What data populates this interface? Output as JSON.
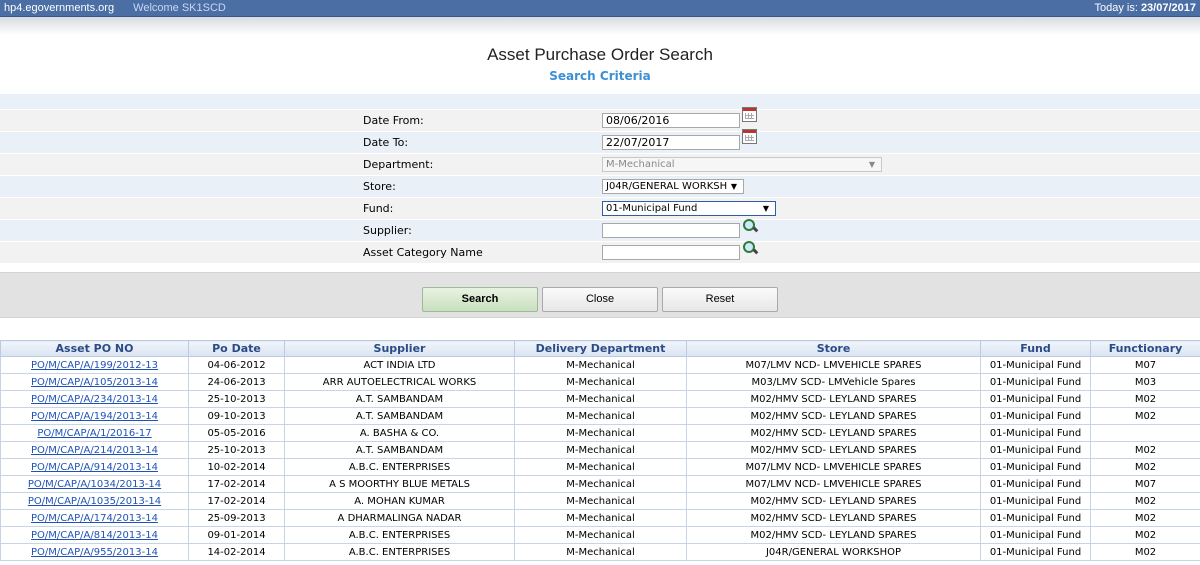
{
  "topbar": {
    "site": "hp4.egovernments.org",
    "welcome": "Welcome SK1SCD",
    "today_label": "Today is: ",
    "today_date": "23/07/2017"
  },
  "page_title": "Asset Purchase Order Search",
  "section_title": "Search Criteria",
  "form": {
    "date_from_label": "Date From:",
    "date_from_value": "08/06/2016",
    "date_to_label": "Date To:",
    "date_to_value": "22/07/2017",
    "department_label": "Department:",
    "department_value": "M-Mechanical",
    "store_label": "Store:",
    "store_value": "J04R/GENERAL WORKSH",
    "fund_label": "Fund:",
    "fund_value": "01-Municipal Fund",
    "supplier_label": "Supplier:",
    "supplier_value": "",
    "asset_category_label": "Asset Category Name",
    "asset_category_value": ""
  },
  "buttons": {
    "search": "Search",
    "close": "Close",
    "reset": "Reset"
  },
  "table": {
    "headers": [
      "Asset PO NO",
      "Po Date",
      "Supplier",
      "Delivery Department",
      "Store",
      "Fund",
      "Functionary"
    ],
    "rows": [
      [
        "PO/M/CAP/A/199/2012-13",
        "04-06-2012",
        "ACT INDIA LTD",
        "M-Mechanical",
        "M07/LMV NCD- LMVEHICLE SPARES",
        "01-Municipal Fund",
        "M07"
      ],
      [
        "PO/M/CAP/A/105/2013-14",
        "24-06-2013",
        "ARR AUTOELECTRICAL WORKS",
        "M-Mechanical",
        "M03/LMV SCD- LMVehicle Spares",
        "01-Municipal Fund",
        "M03"
      ],
      [
        "PO/M/CAP/A/234/2013-14",
        "25-10-2013",
        "A.T. SAMBANDAM",
        "M-Mechanical",
        "M02/HMV SCD- LEYLAND SPARES",
        "01-Municipal Fund",
        "M02"
      ],
      [
        "PO/M/CAP/A/194/2013-14",
        "09-10-2013",
        "A.T. SAMBANDAM",
        "M-Mechanical",
        "M02/HMV SCD- LEYLAND SPARES",
        "01-Municipal Fund",
        "M02"
      ],
      [
        "PO/M/CAP/A/1/2016-17",
        "05-05-2016",
        "A. BASHA & CO.",
        "M-Mechanical",
        "M02/HMV SCD- LEYLAND SPARES",
        "01-Municipal Fund",
        ""
      ],
      [
        "PO/M/CAP/A/214/2013-14",
        "25-10-2013",
        "A.T. SAMBANDAM",
        "M-Mechanical",
        "M02/HMV SCD- LEYLAND SPARES",
        "01-Municipal Fund",
        "M02"
      ],
      [
        "PO/M/CAP/A/914/2013-14",
        "10-02-2014",
        "A.B.C. ENTERPRISES",
        "M-Mechanical",
        "M07/LMV NCD- LMVEHICLE SPARES",
        "01-Municipal Fund",
        "M02"
      ],
      [
        "PO/M/CAP/A/1034/2013-14",
        "17-02-2014",
        "A S MOORTHY BLUE METALS",
        "M-Mechanical",
        "M07/LMV NCD- LMVEHICLE SPARES",
        "01-Municipal Fund",
        "M07"
      ],
      [
        "PO/M/CAP/A/1035/2013-14",
        "17-02-2014",
        "A. MOHAN KUMAR",
        "M-Mechanical",
        "M02/HMV SCD- LEYLAND SPARES",
        "01-Municipal Fund",
        "M02"
      ],
      [
        "PO/M/CAP/A/174/2013-14",
        "25-09-2013",
        "A DHARMALINGA NADAR",
        "M-Mechanical",
        "M02/HMV SCD- LEYLAND SPARES",
        "01-Municipal Fund",
        "M02"
      ],
      [
        "PO/M/CAP/A/814/2013-14",
        "09-01-2014",
        "A.B.C. ENTERPRISES",
        "M-Mechanical",
        "M02/HMV SCD- LEYLAND SPARES",
        "01-Municipal Fund",
        "M02"
      ],
      [
        "PO/M/CAP/A/955/2013-14",
        "14-02-2014",
        "A.B.C. ENTERPRISES",
        "M-Mechanical",
        "J04R/GENERAL WORKSHOP",
        "01-Municipal Fund",
        "M02"
      ]
    ]
  }
}
